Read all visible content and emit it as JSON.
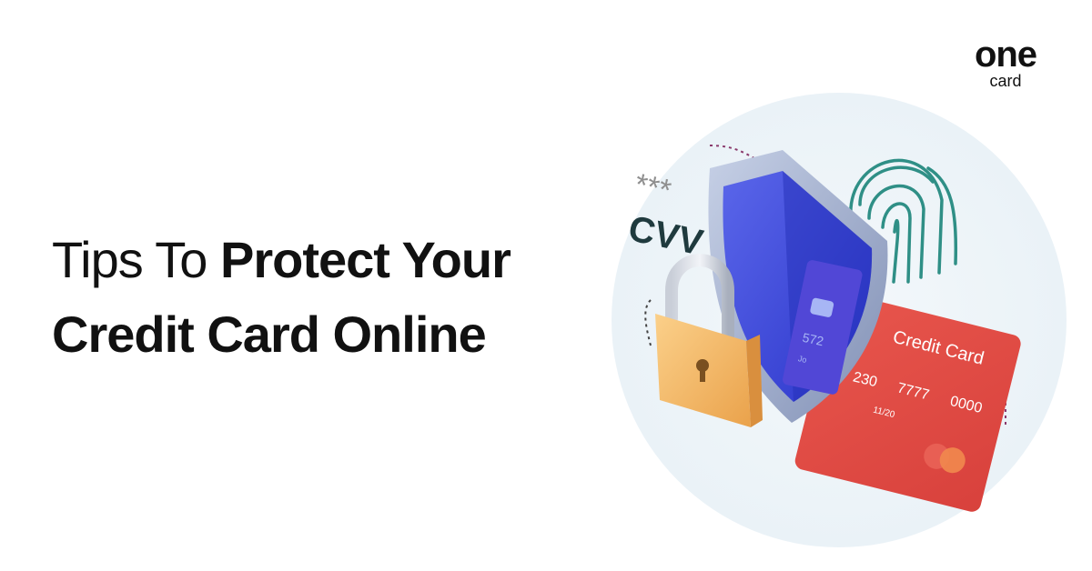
{
  "headline": {
    "line1_light": "Tips To ",
    "line1_bold": "Protect Your",
    "line2_bold": "Credit Card Online"
  },
  "logo": {
    "top": "one",
    "bottom": "card"
  },
  "illustration": {
    "cvv_stars": "***",
    "cvv_label": "CVV",
    "card_title": "Credit Card",
    "card_number_a": "230",
    "card_number_b": "7777",
    "card_number_c": "0000",
    "card_expiry": "11/20",
    "shield_card_digits": "572",
    "shield_card_name": "Jo"
  },
  "colors": {
    "headline": "#111111",
    "background_circle": "#eef4f8",
    "shield_blue": "#3b49d8",
    "shield_rim": "#9aa6c8",
    "card_red": "#e0453f",
    "lock_gold": "#f2b45a",
    "fingerprint_teal": "#2f8f86"
  }
}
